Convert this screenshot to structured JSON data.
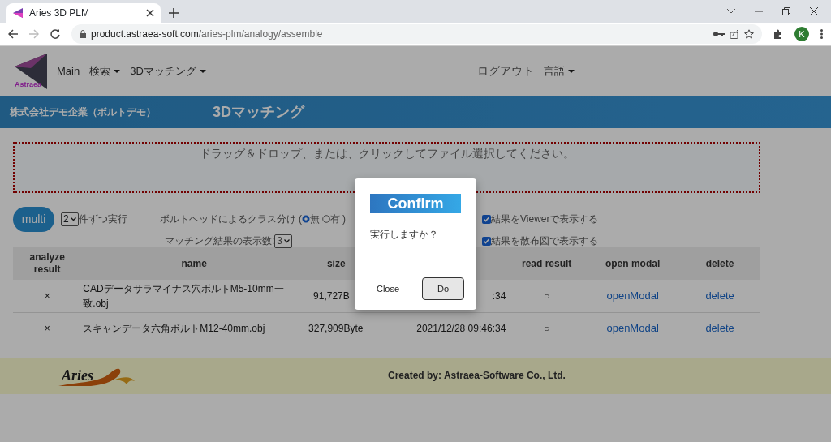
{
  "browser": {
    "tab_title": "Aries 3D PLM",
    "url_host": "product.astraea-soft.com",
    "url_path": "/aries-plm/analogy/assemble",
    "profile_initial": "K"
  },
  "navbar": {
    "logo_text": "Astraea",
    "items": [
      {
        "label": "Main",
        "dropdown": false
      },
      {
        "label": "検索",
        "dropdown": true
      },
      {
        "label": "3Dマッチング",
        "dropdown": true
      }
    ],
    "right_items": [
      {
        "label": "ログアウト",
        "dropdown": false
      },
      {
        "label": "言語",
        "dropdown": true
      }
    ]
  },
  "banner": {
    "company": "株式会社デモ企業（ボルトデモ）",
    "title": "3Dマッチング"
  },
  "dropzone": {
    "text": "ドラッグ＆ドロップ、または、クリックしてファイル選択してください。"
  },
  "controls": {
    "multi_button": "multi",
    "batch_select": "2",
    "batch_label": "件ずつ実行",
    "class_label": "ボルトヘッドによるクラス分け (",
    "radios": [
      {
        "label": "無",
        "selected": true
      },
      {
        "label": "有",
        "selected": false
      }
    ],
    "class_label_end": ")",
    "count_label": "マッチング結果の表示数:",
    "count_select": "3",
    "checkboxes": [
      {
        "label": "結果をViewerで表示する",
        "checked": true
      },
      {
        "label": "結果を散布図で表示する",
        "checked": true
      }
    ]
  },
  "table": {
    "columns": [
      "analyze result",
      "name",
      "size",
      null,
      "read result",
      "open modal",
      "delete"
    ],
    "rows": [
      {
        "analyze": "×",
        "name": "CADデータサラマイナス穴ボルトM5-10mm一致.obj",
        "size": "91,727B",
        "date": ":34",
        "read": "○",
        "open": "openModal",
        "delete": "delete"
      },
      {
        "analyze": "×",
        "name": "スキャンデータ六角ボルトM12-40mm.obj",
        "size": "327,909Byte",
        "date": "2021/12/28 09:46:34",
        "read": "○",
        "open": "openModal",
        "delete": "delete"
      }
    ]
  },
  "footer": {
    "logo_text": "Aries",
    "credit": "Created by: Astraea-Software Co., Ltd."
  },
  "modal": {
    "title": "Confirm",
    "message": "実行しますか？",
    "buttons": [
      {
        "label": "Close",
        "kind": "plain"
      },
      {
        "label": "Do",
        "kind": "outlined"
      }
    ]
  }
}
